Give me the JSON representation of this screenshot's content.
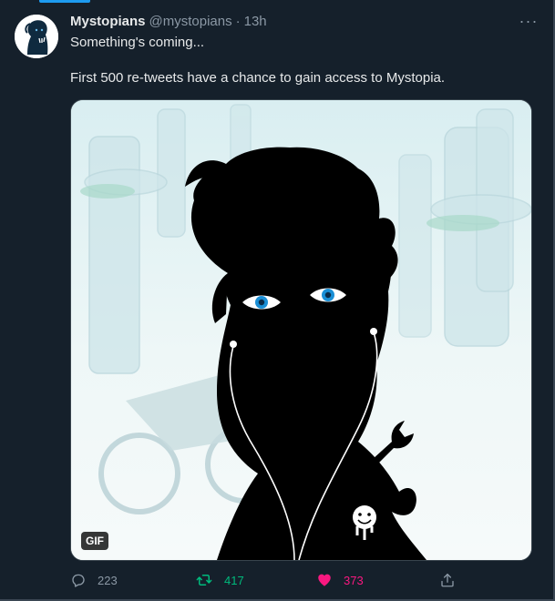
{
  "tweet": {
    "display_name": "Mystopians",
    "handle": "@mystopians",
    "separator": "·",
    "timestamp": "13h",
    "more_label": "···",
    "lines": [
      "Something's coming...",
      "First 500 re-tweets have a chance to gain access to Mystopia."
    ],
    "media": {
      "badge": "GIF"
    },
    "actions": {
      "replies": "223",
      "retweets": "417",
      "likes": "373"
    }
  },
  "colors": {
    "background": "#15202b",
    "accent": "#1d9bf0",
    "retweet": "#00ba7c",
    "like": "#f91880",
    "muted": "#8b98a5"
  },
  "icons": [
    "more-icon",
    "reply-icon",
    "retweet-icon",
    "heart-icon",
    "share-icon"
  ]
}
